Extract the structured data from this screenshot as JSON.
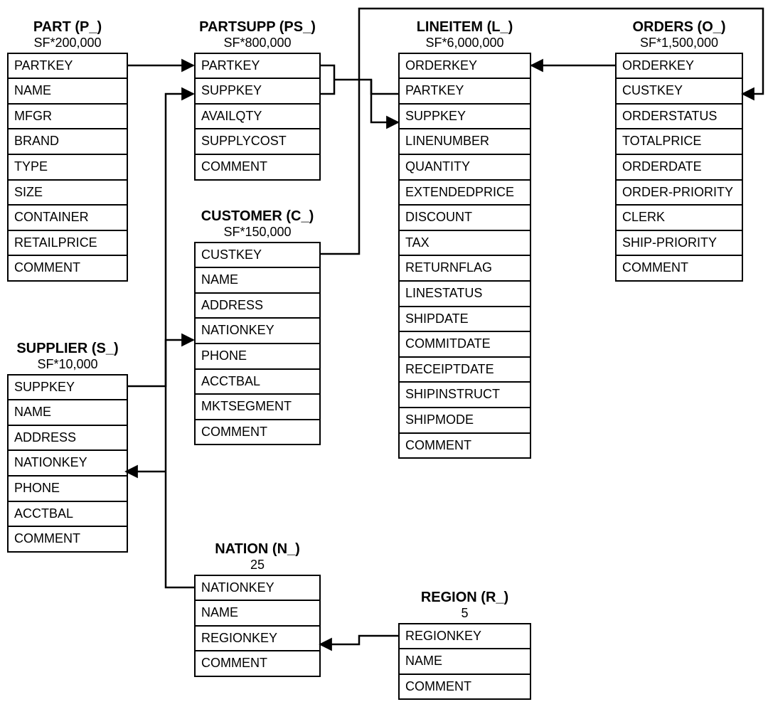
{
  "tables": {
    "part": {
      "title": "PART (P_)",
      "subtitle": "SF*200,000",
      "columns": [
        "PARTKEY",
        "NAME",
        "MFGR",
        "BRAND",
        "TYPE",
        "SIZE",
        "CONTAINER",
        "RETAILPRICE",
        "COMMENT"
      ]
    },
    "supplier": {
      "title": "SUPPLIER (S_)",
      "subtitle": "SF*10,000",
      "columns": [
        "SUPPKEY",
        "NAME",
        "ADDRESS",
        "NATIONKEY",
        "PHONE",
        "ACCTBAL",
        "COMMENT"
      ]
    },
    "partsupp": {
      "title": "PARTSUPP (PS_)",
      "subtitle": "SF*800,000",
      "columns": [
        "PARTKEY",
        "SUPPKEY",
        "AVAILQTY",
        "SUPPLYCOST",
        "COMMENT"
      ]
    },
    "customer": {
      "title": "CUSTOMER (C_)",
      "subtitle": "SF*150,000",
      "columns": [
        "CUSTKEY",
        "NAME",
        "ADDRESS",
        "NATIONKEY",
        "PHONE",
        "ACCTBAL",
        "MKTSEGMENT",
        "COMMENT"
      ]
    },
    "nation": {
      "title": "NATION (N_)",
      "subtitle": "25",
      "columns": [
        "NATIONKEY",
        "NAME",
        "REGIONKEY",
        "COMMENT"
      ]
    },
    "lineitem": {
      "title": "LINEITEM (L_)",
      "subtitle": "SF*6,000,000",
      "columns": [
        "ORDERKEY",
        "PARTKEY",
        "SUPPKEY",
        "LINENUMBER",
        "QUANTITY",
        "EXTENDEDPRICE",
        "DISCOUNT",
        "TAX",
        "RETURNFLAG",
        "LINESTATUS",
        "SHIPDATE",
        "COMMITDATE",
        "RECEIPTDATE",
        "SHIPINSTRUCT",
        "SHIPMODE",
        "COMMENT"
      ]
    },
    "orders": {
      "title": "ORDERS (O_)",
      "subtitle": "SF*1,500,000",
      "columns": [
        "ORDERKEY",
        "CUSTKEY",
        "ORDERSTATUS",
        "TOTALPRICE",
        "ORDERDATE",
        "ORDER-PRIORITY",
        "CLERK",
        "SHIP-PRIORITY",
        "COMMENT"
      ]
    },
    "region": {
      "title": "REGION (R_)",
      "subtitle": "5",
      "columns": [
        "REGIONKEY",
        "NAME",
        "COMMENT"
      ]
    }
  }
}
